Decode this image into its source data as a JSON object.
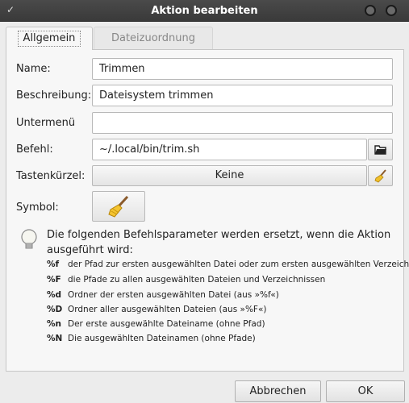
{
  "window": {
    "title": "Aktion bearbeiten"
  },
  "tabs": [
    {
      "label": "Allgemein",
      "active": true
    },
    {
      "label": "Dateizuordnung",
      "active": false
    }
  ],
  "form": {
    "name_label": "Name:",
    "name_value": "Trimmen",
    "description_label": "Beschreibung:",
    "description_value": "Dateisystem trimmen",
    "submenu_label": "Untermenü",
    "submenu_value": "",
    "command_label": "Befehl:",
    "command_value": "~/.local/bin/trim.sh",
    "shortcut_label": "Tastenkürzel:",
    "shortcut_value": "Keine",
    "icon_label": "Symbol:"
  },
  "info": {
    "text": "Die folgenden Befehlsparameter werden ersetzt, wenn die Aktion ausgeführt wird:",
    "params": [
      {
        "key": "%f",
        "desc": "der Pfad zur ersten ausgewählten Datei oder zum ersten ausgewählten Verzeichnis"
      },
      {
        "key": "%F",
        "desc": "die Pfade zu allen ausgewählten Dateien und Verzeichnissen"
      },
      {
        "key": "%d",
        "desc": "Ordner der ersten ausgewählten Datei (aus »%f«)"
      },
      {
        "key": "%D",
        "desc": "Ordner aller ausgewählten Dateien (aus »%F«)"
      },
      {
        "key": "%n",
        "desc": "Der erste ausgewählte Dateiname (ohne Pfad)"
      },
      {
        "key": "%N",
        "desc": "Die ausgewählten Dateinamen (ohne Pfade)"
      }
    ]
  },
  "footer": {
    "cancel_label": "Abbrechen",
    "ok_label": "OK"
  },
  "icons": {
    "window_menu": "chevron-down-icon",
    "browse": "open-folder-icon",
    "shortcut_clear": "broom-icon",
    "symbol": "broom-icon",
    "info": "lightbulb-icon"
  },
  "colors": {
    "titlebar": "#3f3f3f",
    "panel": "#f7f7f7",
    "window": "#ececec"
  }
}
